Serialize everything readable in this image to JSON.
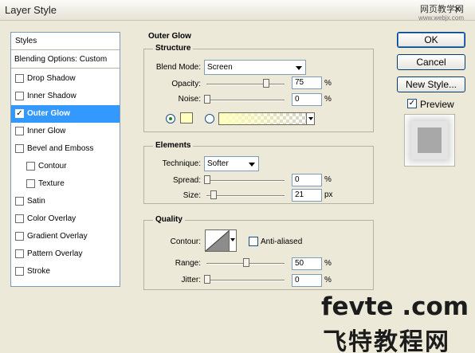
{
  "window": {
    "title": "Layer Style",
    "close_glyph": "×",
    "watermark_site": "网页教学网",
    "watermark_url": "www.webjx.com"
  },
  "styles_list": {
    "header": "Styles",
    "blending": "Blending Options: Custom",
    "items": [
      {
        "label": "Drop Shadow",
        "checked": false,
        "selected": false,
        "indent": false
      },
      {
        "label": "Inner Shadow",
        "checked": false,
        "selected": false,
        "indent": false
      },
      {
        "label": "Outer Glow",
        "checked": true,
        "selected": true,
        "indent": false
      },
      {
        "label": "Inner Glow",
        "checked": false,
        "selected": false,
        "indent": false
      },
      {
        "label": "Bevel and Emboss",
        "checked": false,
        "selected": false,
        "indent": false
      },
      {
        "label": "Contour",
        "checked": false,
        "selected": false,
        "indent": true
      },
      {
        "label": "Texture",
        "checked": false,
        "selected": false,
        "indent": true
      },
      {
        "label": "Satin",
        "checked": false,
        "selected": false,
        "indent": false
      },
      {
        "label": "Color Overlay",
        "checked": false,
        "selected": false,
        "indent": false
      },
      {
        "label": "Gradient Overlay",
        "checked": false,
        "selected": false,
        "indent": false
      },
      {
        "label": "Pattern Overlay",
        "checked": false,
        "selected": false,
        "indent": false
      },
      {
        "label": "Stroke",
        "checked": false,
        "selected": false,
        "indent": false
      }
    ]
  },
  "outer_glow": {
    "title": "Outer Glow",
    "structure": {
      "title": "Structure",
      "blend_mode_label": "Blend Mode:",
      "blend_mode_value": "Screen",
      "opacity_label": "Opacity:",
      "opacity_value": "75",
      "opacity_fraction": 0.75,
      "opacity_unit": "%",
      "noise_label": "Noise:",
      "noise_value": "0",
      "noise_fraction": 0,
      "noise_unit": "%",
      "glow_color": "#ffffbe",
      "solid_color_radio_selected": true
    },
    "elements": {
      "title": "Elements",
      "technique_label": "Technique:",
      "technique_value": "Softer",
      "spread_label": "Spread:",
      "spread_value": "0",
      "spread_fraction": 0,
      "spread_unit": "%",
      "size_label": "Size:",
      "size_value": "21",
      "size_fraction": 0.085,
      "size_unit": "px"
    },
    "quality": {
      "title": "Quality",
      "contour_label": "Contour:",
      "anti_aliased_label": "Anti-aliased",
      "anti_aliased_checked": false,
      "range_label": "Range:",
      "range_value": "50",
      "range_fraction": 0.5,
      "range_unit": "%",
      "jitter_label": "Jitter:",
      "jitter_value": "0",
      "jitter_fraction": 0,
      "jitter_unit": "%"
    }
  },
  "buttons": {
    "ok": "OK",
    "cancel": "Cancel",
    "new_style": "New Style...",
    "preview_label": "Preview",
    "preview_checked": true
  },
  "watermark": {
    "line1": "fevte .com",
    "line2": "飞特教程网"
  },
  "colors": {
    "selection": "#3399ff",
    "dialog_bg": "#ece9d8",
    "glow": "#ffffbe"
  }
}
